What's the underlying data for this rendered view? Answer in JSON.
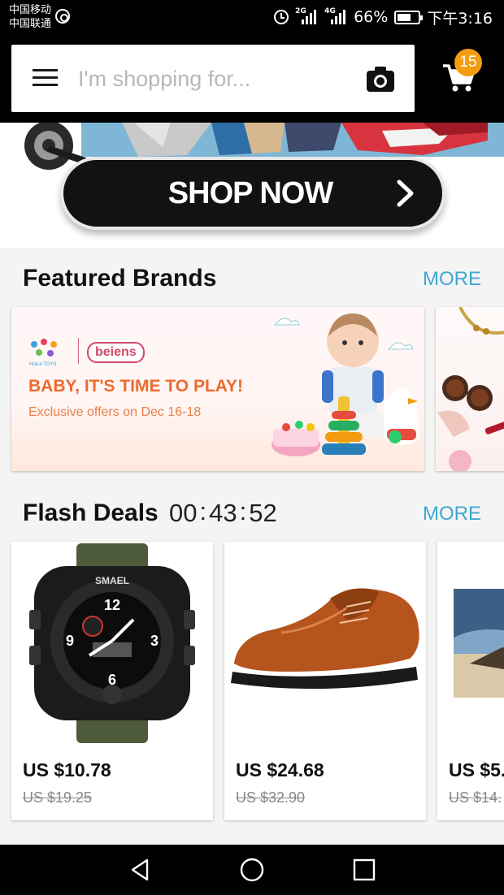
{
  "status_bar": {
    "carrier_1": "中国移动",
    "carrier_2": "中国联通",
    "network_1": "2G",
    "network_2": "4G",
    "battery_text": "66%",
    "battery_level": 0.66,
    "time": "下午3:16"
  },
  "header": {
    "search_placeholder": "I'm shopping for...",
    "cart_count": "15",
    "badge_color": "#f39c12"
  },
  "banner": {
    "cta_label": "SHOP NOW"
  },
  "featured_brands": {
    "title": "Featured Brands",
    "more_label": "MORE",
    "cards": [
      {
        "logo_1_sub": "HuiLe TOYS",
        "logo_2": "beiens",
        "headline": "BABY, IT'S TIME TO PLAY!",
        "subline": "Exclusive offers on Dec 16-18"
      }
    ]
  },
  "flash_deals": {
    "title": "Flash Deals",
    "more_label": "MORE",
    "countdown": {
      "hours": "00",
      "minutes": "43",
      "seconds": "52",
      "separator": ":"
    },
    "items": [
      {
        "price": "US $10.78",
        "original_price": "US $19.25",
        "image": "watch"
      },
      {
        "price": "US $24.68",
        "original_price": "US $32.90",
        "image": "shoe"
      },
      {
        "price": "US $5.",
        "original_price": "US $14.",
        "image": "canvas-print"
      }
    ]
  },
  "colors": {
    "accent": "#3ea7d3",
    "brand_headline": "#ee6a2d"
  }
}
